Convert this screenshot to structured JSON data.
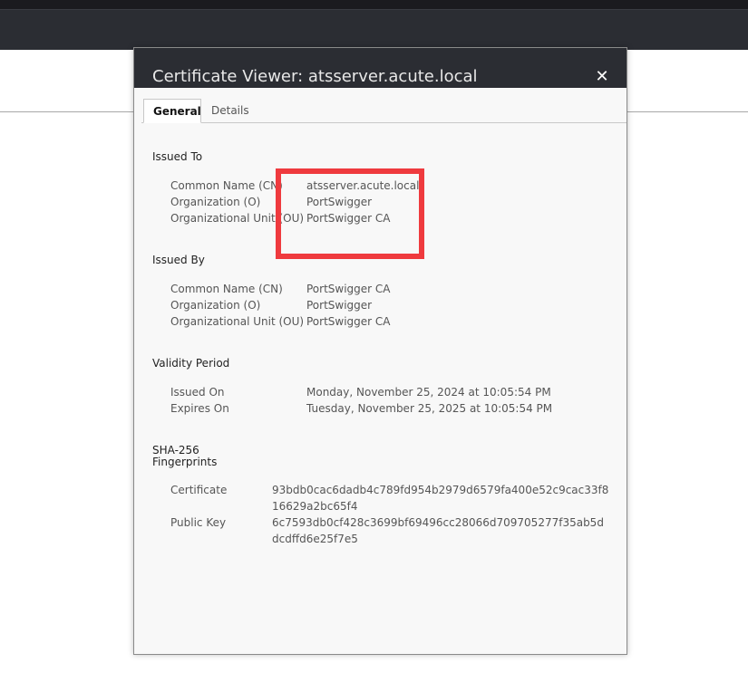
{
  "dialog": {
    "title": "Certificate Viewer: atsserver.acute.local",
    "close_glyph": "✕"
  },
  "tabs": [
    {
      "label": "General",
      "active": true
    },
    {
      "label": "Details",
      "active": false
    }
  ],
  "issued_to": {
    "title": "Issued To",
    "rows": [
      {
        "label": "Common Name (CN)",
        "value": "atsserver.acute.local"
      },
      {
        "label": "Organization (O)",
        "value": "PortSwigger"
      },
      {
        "label": "Organizational Unit (OU)",
        "value": "PortSwigger CA"
      }
    ]
  },
  "issued_by": {
    "title": "Issued By",
    "rows": [
      {
        "label": "Common Name (CN)",
        "value": "PortSwigger CA"
      },
      {
        "label": "Organization (O)",
        "value": "PortSwigger"
      },
      {
        "label": "Organizational Unit (OU)",
        "value": "PortSwigger CA"
      }
    ]
  },
  "validity": {
    "title": "Validity Period",
    "rows": [
      {
        "label": "Issued On",
        "value": "Monday, November 25, 2024 at 10:05:54 PM"
      },
      {
        "label": "Expires On",
        "value": "Tuesday, November 25, 2025 at 10:05:54 PM"
      }
    ]
  },
  "fingerprints": {
    "title_line1": "SHA-256",
    "title_line2": "Fingerprints",
    "rows": [
      {
        "label": "Certificate",
        "value": "93bdb0cac6dadb4c789fd954b2979d6579fa400e52c9cac33f816629a2bc65f4"
      },
      {
        "label": "Public Key",
        "value": "6c7593db0cf428c3699bf69496cc28066d709705277f35ab5ddcdffd6e25f7e5"
      }
    ]
  },
  "colors": {
    "header_bg": "#2b2d33",
    "highlight": "#ef3a3e",
    "dialog_bg": "#f8f8f8"
  }
}
